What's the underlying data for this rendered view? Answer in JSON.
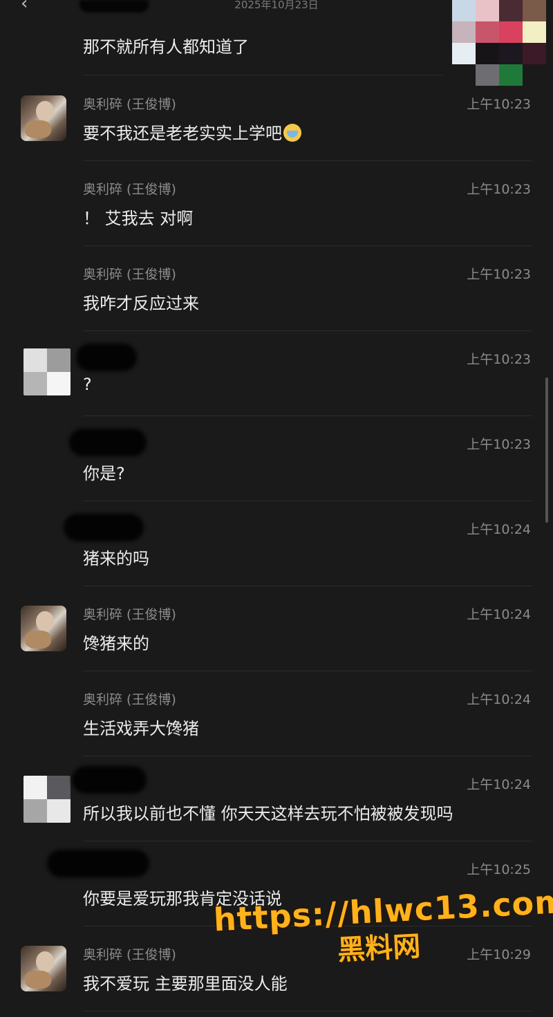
{
  "header": {
    "date": "2025年10月23日",
    "back_glyph": "‹",
    "status_text": ""
  },
  "messages": [
    {
      "id": 0,
      "sender": "",
      "time": "",
      "text": "那不就所有人都知道了",
      "avatar": "none"
    },
    {
      "id": 1,
      "sender": "奥利碎 (王俊博)",
      "time": "上午10:23",
      "text": "要不我还是老老实实上学吧",
      "emoji": "crying-face",
      "avatar": "photo"
    },
    {
      "id": 2,
      "sender": "奥利碎 (王俊博)",
      "time": "上午10:23",
      "text": "！ 艾我去 对啊",
      "avatar": "none"
    },
    {
      "id": 3,
      "sender": "奥利碎 (王俊博)",
      "time": "上午10:23",
      "text": "我咋才反应过来",
      "avatar": "none"
    },
    {
      "id": 4,
      "sender": "",
      "time": "上午10:23",
      "text": "?",
      "avatar": "mosaic"
    },
    {
      "id": 5,
      "sender": "",
      "time": "上午10:23",
      "text": "你是?",
      "avatar": "none"
    },
    {
      "id": 6,
      "sender": "",
      "time": "上午10:24",
      "text": "猪来的吗",
      "avatar": "none"
    },
    {
      "id": 7,
      "sender": "奥利碎 (王俊博)",
      "time": "上午10:24",
      "text": "馋猪来的",
      "avatar": "photo"
    },
    {
      "id": 8,
      "sender": "奥利碎 (王俊博)",
      "time": "上午10:24",
      "text": "生活戏弄大馋猪",
      "avatar": "none"
    },
    {
      "id": 9,
      "sender": "",
      "time": "上午10:24",
      "text": "所以我以前也不懂 你天天这样去玩不怕被被发现吗",
      "avatar": "mosaic"
    },
    {
      "id": 10,
      "sender": "",
      "time": "上午10:25",
      "text": "你要是爱玩那我肯定没话说",
      "avatar": "none"
    },
    {
      "id": 11,
      "sender": "奥利碎 (王俊博)",
      "time": "上午10:29",
      "text": "我不爱玩 主要那里面没人能",
      "avatar": "photo"
    }
  ],
  "watermark": {
    "url": "https://hlwc13.com",
    "name": "黑料网"
  },
  "colors": {
    "background": "#1a1a1a",
    "text": "#ececec",
    "meta": "#8c8c8c",
    "watermark": "#ffb21c"
  }
}
